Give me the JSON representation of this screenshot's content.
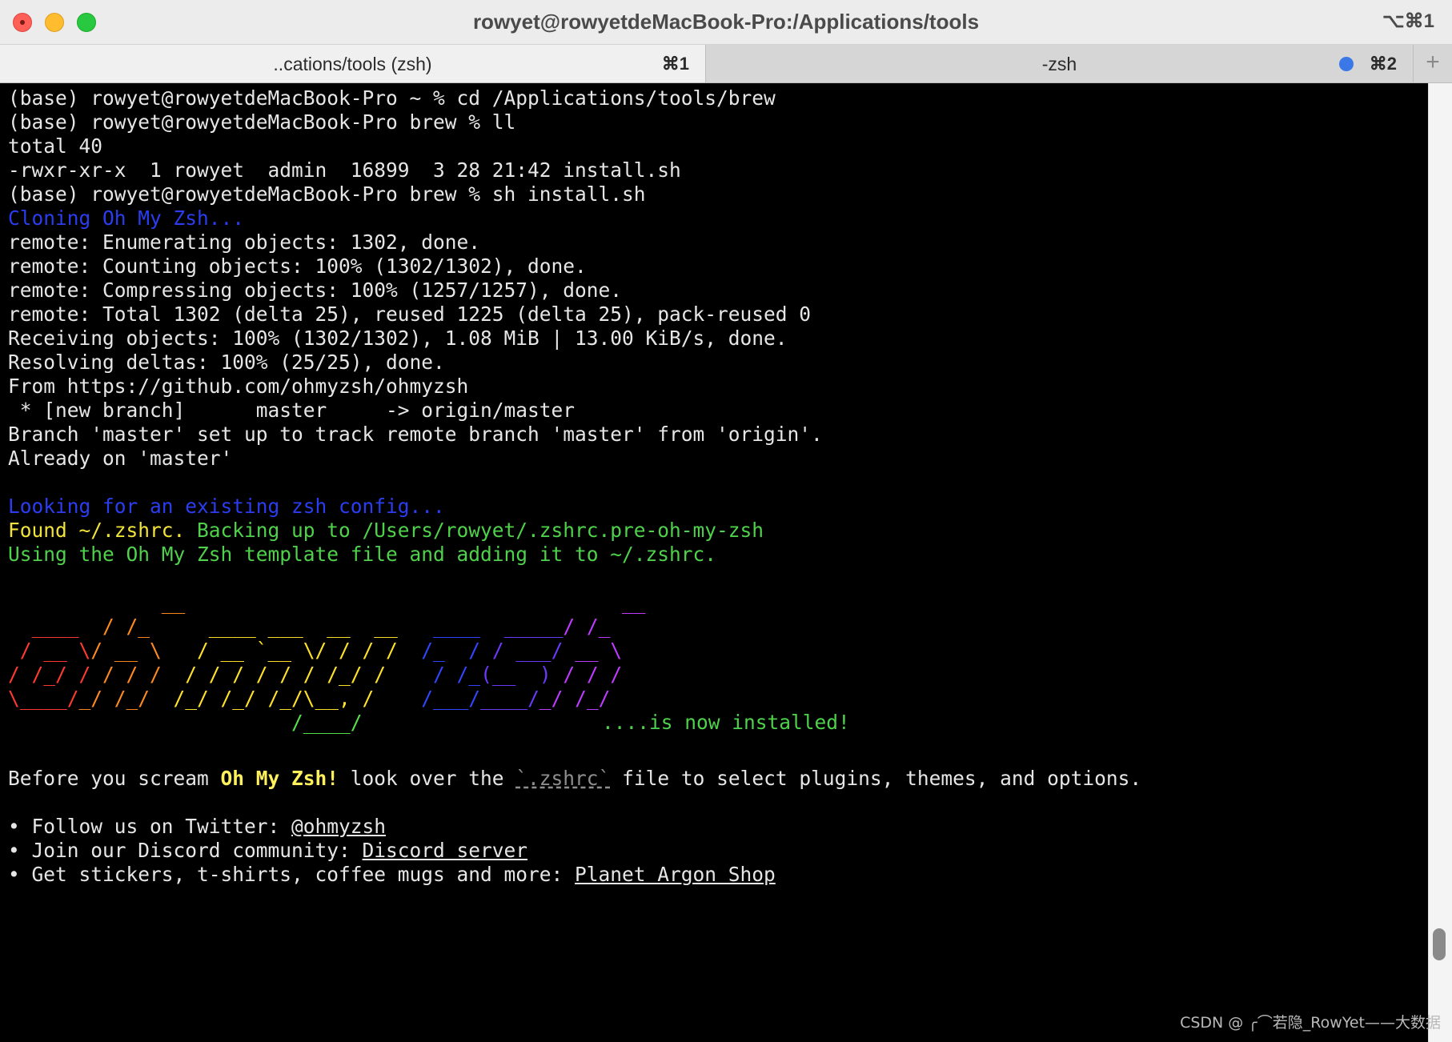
{
  "window": {
    "title": "rowyet@rowyetdeMacBook-Pro:/Applications/tools",
    "shortcut": "⌥⌘1"
  },
  "tabs": [
    {
      "label": "..cations/tools (zsh)",
      "shortcut": "⌘1"
    },
    {
      "label": "-zsh",
      "shortcut": "⌘2"
    }
  ],
  "new_tab_label": "+",
  "terminal": {
    "lines": [
      "(base) rowyet@rowyetdeMacBook-Pro ~ % cd /Applications/tools/brew",
      "(base) rowyet@rowyetdeMacBook-Pro brew % ll",
      "total 40",
      "-rwxr-xr-x  1 rowyet  admin  16899  3 28 21:42 install.sh",
      "(base) rowyet@rowyetdeMacBook-Pro brew % sh install.sh",
      "Cloning Oh My Zsh...",
      "remote: Enumerating objects: 1302, done.",
      "remote: Counting objects: 100% (1302/1302), done.",
      "remote: Compressing objects: 100% (1257/1257), done.",
      "remote: Total 1302 (delta 25), reused 1225 (delta 25), pack-reused 0",
      "Receiving objects: 100% (1302/1302), 1.08 MiB | 13.00 KiB/s, done.",
      "Resolving deltas: 100% (25/25), done.",
      "From https://github.com/ohmyzsh/ohmyzsh",
      " * [new branch]      master     -> origin/master",
      "Branch 'master' set up to track remote branch 'master' from 'origin'.",
      "Already on 'master'",
      "Looking for an existing zsh config...",
      "Found ~/.zshrc. Backing up to /Users/rowyet/.zshrc.pre-oh-my-zsh",
      "Using the Oh My Zsh template file and adding it to ~/.zshrc."
    ],
    "installed_msg": "....is now installed!",
    "before_scream": {
      "pre": "Before you scream ",
      "bold": "Oh My Zsh!",
      "mid": " look over the ",
      "file": "`.zshrc`",
      "post": " file to select plugins, themes, and options."
    },
    "bullets": [
      {
        "text": "• Follow us on Twitter: ",
        "link": "@ohmyzsh"
      },
      {
        "text": "• Join our Discord community: ",
        "link": "Discord server"
      },
      {
        "text": "• Get stickers, t-shirts, coffee mugs and more: ",
        "link": "Planet Argon Shop"
      }
    ]
  },
  "watermark": "CSDN @ ╭⌒若隐_RowYet——大数据"
}
